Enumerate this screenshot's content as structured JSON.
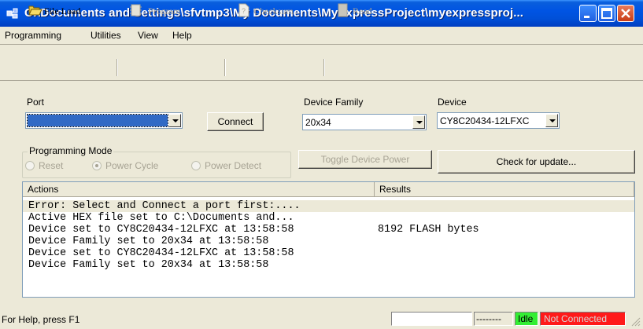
{
  "window": {
    "title": "C:\\Documents and Settings\\sfvtmp3\\My Documents\\MyExpressProject\\myexpressproj...",
    "controls": {
      "minimize_icon": "minimize-icon",
      "maximize_icon": "maximize-icon",
      "close_icon": "close-icon"
    }
  },
  "menu": [
    "Programming",
    "Utilities",
    "View",
    "Help"
  ],
  "toolbar": {
    "file_load": "File Load",
    "program": "Program",
    "checksum": "Checksum",
    "read": "Read"
  },
  "form": {
    "port_label": "Port",
    "port_value": "",
    "connect_label": "Connect",
    "device_family_label": "Device Family",
    "device_family_value": "20x34",
    "device_label": "Device",
    "device_value": "CY8C20434-12LFXC",
    "programming_mode_label": "Programming Mode",
    "modes": [
      {
        "label": "Reset",
        "selected": false
      },
      {
        "label": "Power Cycle",
        "selected": true
      },
      {
        "label": "Power Detect",
        "selected": false
      }
    ],
    "toggle_power_label": "Toggle Device Power",
    "check_update_label": "Check for update..."
  },
  "log": {
    "columns": [
      "Actions",
      "Results"
    ],
    "rows": [
      {
        "action": "Error: Select and Connect a port first:....",
        "result": ""
      },
      {
        "action": "Active HEX file set to C:\\Documents and...",
        "result": ""
      },
      {
        "action": "Device set to CY8C20434-12LFXC at 13:58:58",
        "result": "8192 FLASH bytes"
      },
      {
        "action": "Device Family set to 20x34 at 13:58:58",
        "result": ""
      },
      {
        "action": "Device set to CY8C20434-12LFXC at 13:58:58",
        "result": ""
      },
      {
        "action": "Device Family set to 20x34 at 13:58:58",
        "result": ""
      }
    ]
  },
  "status": {
    "help_text": "For Help, press F1",
    "panel_blank": "",
    "panel_dashes": "--------",
    "idle": "Idle",
    "connection": "Not Connected",
    "colors": {
      "idle_bg": "#33ee33",
      "connection_bg": "#ff1a1a",
      "title_bar": "#0054e3"
    }
  }
}
